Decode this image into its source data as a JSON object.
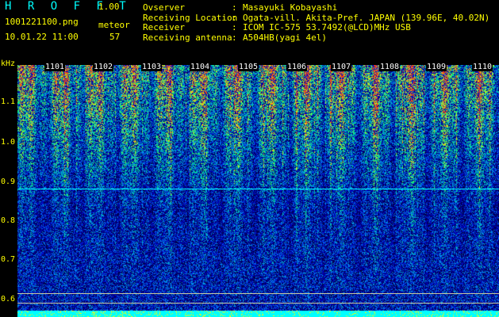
{
  "header": {
    "app_title": "H R O F F T",
    "version": "1.00",
    "filename": "1001221100.png",
    "datetime": "10.01.22 11:00",
    "meteor_label": "meteor",
    "meteor_count": "57"
  },
  "info": [
    {
      "label": "Ovserver",
      "sep": ":",
      "value": "Masayuki Kobayashi"
    },
    {
      "label": "Receiving Location",
      "sep": ":",
      "value": "Ogata-vill. Akita-Pref. JAPAN (139.96E, 40.02N)"
    },
    {
      "label": "Receiver",
      "sep": ":",
      "value": "ICOM IC-575 53.7492(@LCD)MHz USB"
    },
    {
      "label": "Receiving antenna",
      "sep": ":",
      "value": "A504HB(yagi 4el)"
    }
  ],
  "plot": {
    "y_unit": "kHz",
    "y_ticks": [
      "1.1",
      "1.0",
      "0.9",
      "0.8",
      "0.7",
      "0.6"
    ],
    "x_ticks": [
      "1101",
      "1102",
      "1103",
      "1104",
      "1105",
      "1106",
      "1107",
      "1108",
      "1109",
      "1110"
    ],
    "colors": {
      "text": "#ffff00",
      "accent": "#00ffff",
      "marker_line": "#00ffff",
      "reference_line": "#c8c8a0"
    }
  }
}
